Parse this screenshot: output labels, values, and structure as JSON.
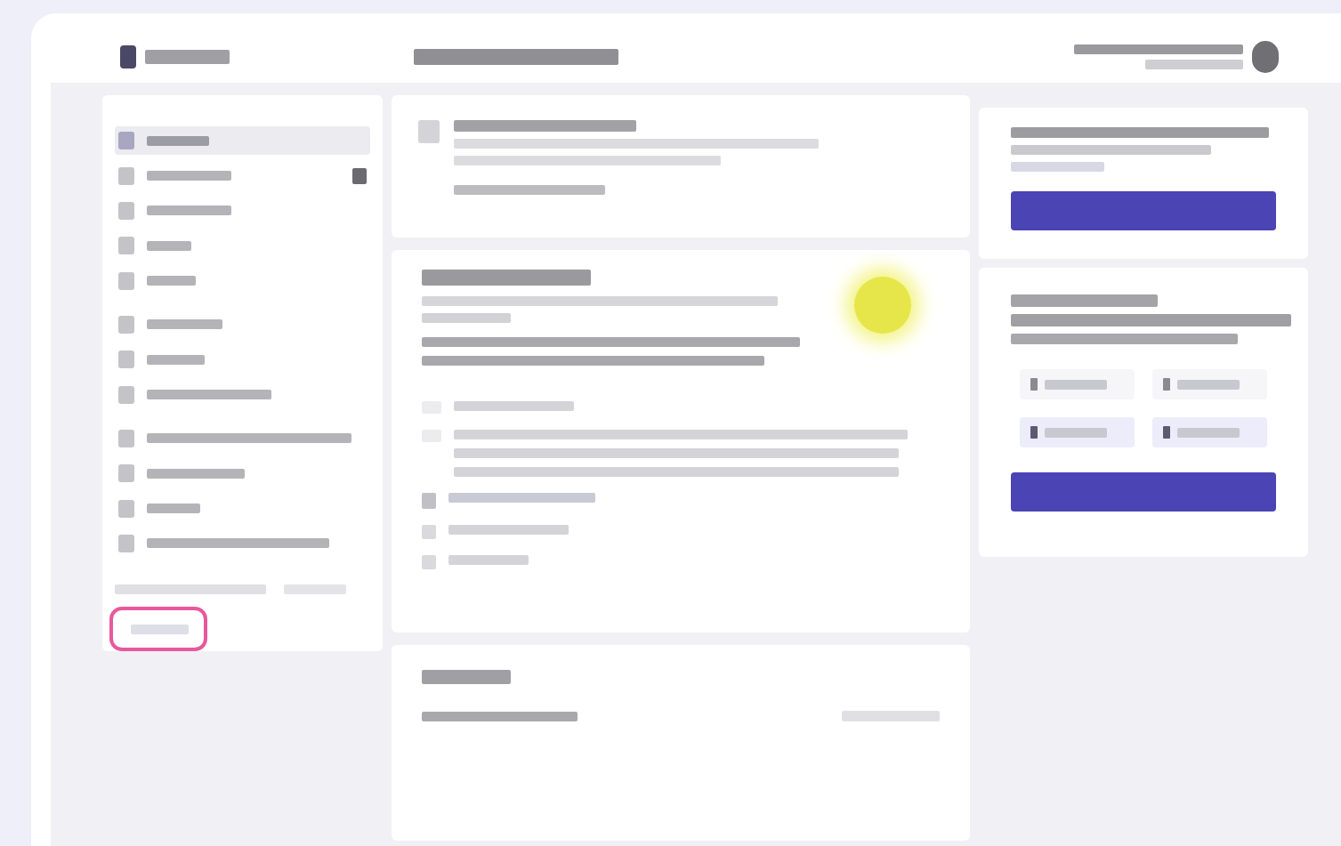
{
  "header": {
    "logo": {
      "kind": "mark"
    },
    "user": {
      "avatar": true
    }
  },
  "sidebar": {
    "items": [
      {
        "selected": true,
        "badge": false,
        "group_start": false
      },
      {
        "selected": false,
        "badge": true,
        "group_start": false
      },
      {
        "selected": false,
        "badge": false,
        "group_start": false
      },
      {
        "selected": false,
        "badge": false,
        "group_start": false
      },
      {
        "selected": false,
        "badge": false,
        "group_start": false
      },
      {
        "selected": false,
        "badge": false,
        "group_start": true
      },
      {
        "selected": false,
        "badge": false,
        "group_start": false
      },
      {
        "selected": false,
        "badge": false,
        "group_start": false
      },
      {
        "selected": false,
        "badge": false,
        "group_start": true
      },
      {
        "selected": false,
        "badge": false,
        "group_start": false
      },
      {
        "selected": false,
        "badge": false,
        "group_start": false
      },
      {
        "selected": false,
        "badge": false,
        "group_start": false
      }
    ],
    "footer_link": {
      "highlighted": true
    }
  },
  "notice": {
    "link": true
  },
  "feature": {
    "highlight": true,
    "items": [
      {
        "kind": "text"
      },
      {
        "kind": "paragraph"
      },
      {
        "kind": "check"
      },
      {
        "kind": "plain"
      },
      {
        "kind": "plain"
      }
    ]
  },
  "promo": {
    "button": true
  },
  "options": {
    "items": [
      {
        "selected": false
      },
      {
        "selected": false
      },
      {
        "selected": true
      },
      {
        "selected": true
      }
    ],
    "button": true
  }
}
